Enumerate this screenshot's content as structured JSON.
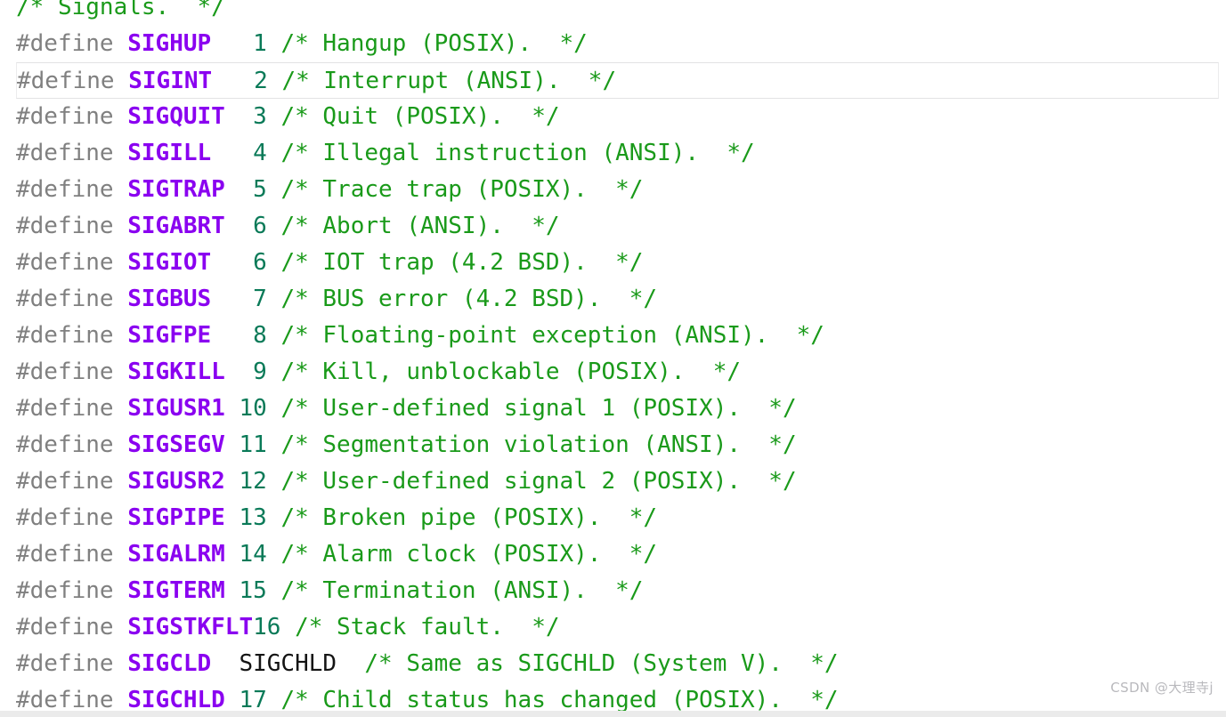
{
  "editor": {
    "language": "c-header",
    "colors": {
      "background": "#ffffff",
      "keyword": "#808080",
      "symbol": "#8a00f0",
      "number": "#0a7a58",
      "value": "#141414",
      "comment": "#1a9a1a",
      "current_line_border": "#e2e2e4",
      "bottom_strip": "#ebebeb",
      "watermark": "#b9b9bd"
    },
    "current_line_index": 2,
    "lines": [
      {
        "kind": "comment-only",
        "comment": "/* Signals.  */"
      },
      {
        "kind": "define",
        "keyword": "#define",
        "symbol": "SIGHUP",
        "value": "1",
        "value_kind": "number",
        "comment": "/* Hangup (POSIX).  */"
      },
      {
        "kind": "define",
        "keyword": "#define",
        "symbol": "SIGINT",
        "value": "2",
        "value_kind": "number",
        "comment": "/* Interrupt (ANSI).  */"
      },
      {
        "kind": "define",
        "keyword": "#define",
        "symbol": "SIGQUIT",
        "value": "3",
        "value_kind": "number",
        "comment": "/* Quit (POSIX).  */"
      },
      {
        "kind": "define",
        "keyword": "#define",
        "symbol": "SIGILL",
        "value": "4",
        "value_kind": "number",
        "comment": "/* Illegal instruction (ANSI).  */"
      },
      {
        "kind": "define",
        "keyword": "#define",
        "symbol": "SIGTRAP",
        "value": "5",
        "value_kind": "number",
        "comment": "/* Trace trap (POSIX).  */"
      },
      {
        "kind": "define",
        "keyword": "#define",
        "symbol": "SIGABRT",
        "value": "6",
        "value_kind": "number",
        "comment": "/* Abort (ANSI).  */"
      },
      {
        "kind": "define",
        "keyword": "#define",
        "symbol": "SIGIOT",
        "value": "6",
        "value_kind": "number",
        "comment": "/* IOT trap (4.2 BSD).  */"
      },
      {
        "kind": "define",
        "keyword": "#define",
        "symbol": "SIGBUS",
        "value": "7",
        "value_kind": "number",
        "comment": "/* BUS error (4.2 BSD).  */"
      },
      {
        "kind": "define",
        "keyword": "#define",
        "symbol": "SIGFPE",
        "value": "8",
        "value_kind": "number",
        "comment": "/* Floating-point exception (ANSI).  */"
      },
      {
        "kind": "define",
        "keyword": "#define",
        "symbol": "SIGKILL",
        "value": "9",
        "value_kind": "number",
        "comment": "/* Kill, unblockable (POSIX).  */"
      },
      {
        "kind": "define",
        "keyword": "#define",
        "symbol": "SIGUSR1",
        "value": "10",
        "value_kind": "number",
        "comment": "/* User-defined signal 1 (POSIX).  */"
      },
      {
        "kind": "define",
        "keyword": "#define",
        "symbol": "SIGSEGV",
        "value": "11",
        "value_kind": "number",
        "comment": "/* Segmentation violation (ANSI).  */"
      },
      {
        "kind": "define",
        "keyword": "#define",
        "symbol": "SIGUSR2",
        "value": "12",
        "value_kind": "number",
        "comment": "/* User-defined signal 2 (POSIX).  */"
      },
      {
        "kind": "define",
        "keyword": "#define",
        "symbol": "SIGPIPE",
        "value": "13",
        "value_kind": "number",
        "comment": "/* Broken pipe (POSIX).  */"
      },
      {
        "kind": "define",
        "keyword": "#define",
        "symbol": "SIGALRM",
        "value": "14",
        "value_kind": "number",
        "comment": "/* Alarm clock (POSIX).  */"
      },
      {
        "kind": "define",
        "keyword": "#define",
        "symbol": "SIGTERM",
        "value": "15",
        "value_kind": "number",
        "comment": "/* Termination (ANSI).  */"
      },
      {
        "kind": "define",
        "keyword": "#define",
        "symbol": "SIGSTKFLT",
        "value": "16",
        "value_kind": "number",
        "comment": "/* Stack fault.  */"
      },
      {
        "kind": "define",
        "keyword": "#define",
        "symbol": "SIGCLD",
        "value": "SIGCHLD",
        "value_kind": "identifier",
        "comment": "/* Same as SIGCHLD (System V).  */"
      },
      {
        "kind": "define",
        "keyword": "#define",
        "symbol": "SIGCHLD",
        "value": "17",
        "value_kind": "number",
        "comment": "/* Child status has changed (POSIX).  */"
      }
    ]
  },
  "watermark": {
    "text": "CSDN @大理寺j"
  }
}
